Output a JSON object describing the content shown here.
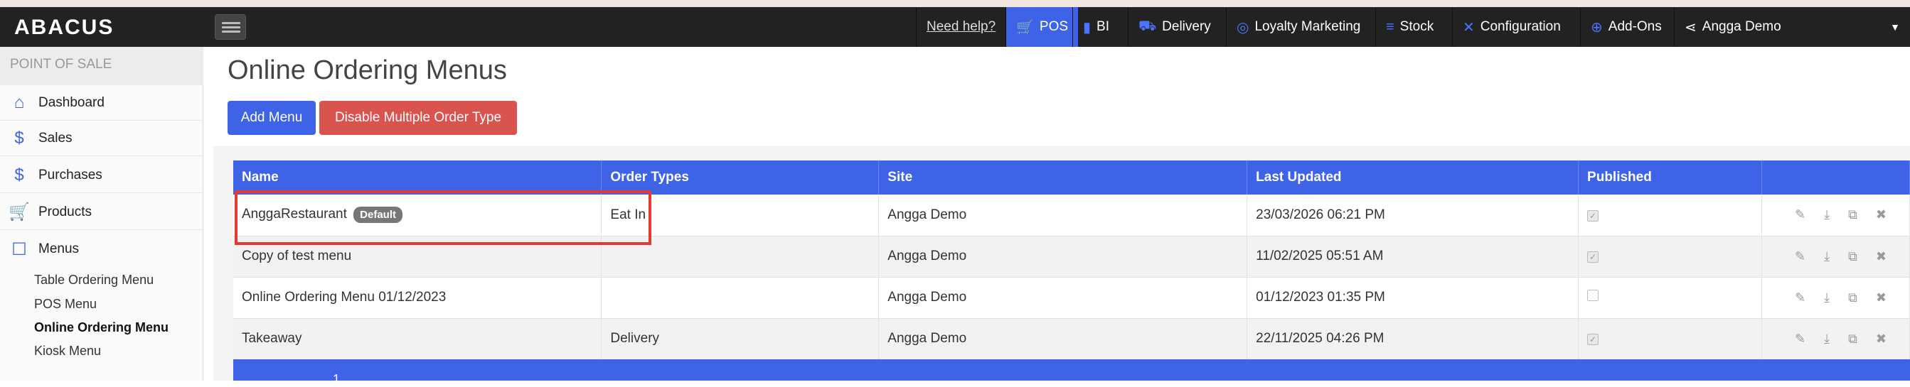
{
  "app": {
    "logo": "ABACUS"
  },
  "navbar": {
    "help": "Need help?",
    "items": [
      {
        "label": "POS",
        "icon": "cart-icon"
      },
      {
        "label": "BI",
        "icon": "bar-chart-icon"
      },
      {
        "label": "Delivery",
        "icon": "truck-icon"
      },
      {
        "label": "Loyalty Marketing",
        "icon": "loyalty-icon"
      },
      {
        "label": "Stock",
        "icon": "stock-icon"
      },
      {
        "label": "Configuration",
        "icon": "wrench-icon"
      },
      {
        "label": "Add-Ons",
        "icon": "plus-circle-icon"
      }
    ],
    "user": "Angga Demo"
  },
  "sidebar": {
    "section": "POINT OF SALE",
    "items": [
      {
        "label": "Dashboard",
        "icon": "home-icon"
      },
      {
        "label": "Sales",
        "icon": "dollar-icon"
      },
      {
        "label": "Purchases",
        "icon": "dollar-icon"
      },
      {
        "label": "Products",
        "icon": "cart-icon"
      },
      {
        "label": "Menus",
        "icon": "menu-book-icon"
      }
    ],
    "submenu": [
      "Table Ordering Menu",
      "POS Menu",
      "Online Ordering Menu",
      "Kiosk Menu"
    ]
  },
  "page": {
    "title": "Online Ordering Menus",
    "add_button": "Add Menu",
    "disable_button": "Disable Multiple Order Type"
  },
  "table": {
    "headers": [
      "Name",
      "Order Types",
      "Site",
      "Last Updated",
      "Published",
      ""
    ],
    "rows": [
      {
        "name": "AnggaRestaurant",
        "badge": "Default",
        "order_types": "Eat In",
        "site": "Angga Demo",
        "updated": "23/03/2026 06:21 PM",
        "published": true
      },
      {
        "name": "Copy of test menu",
        "badge": "",
        "order_types": "",
        "site": "Angga Demo",
        "updated": "11/02/2025 05:51 AM",
        "published": true
      },
      {
        "name": "Online Ordering Menu 01/12/2023",
        "badge": "",
        "order_types": "",
        "site": "Angga Demo",
        "updated": "01/12/2023 01:35 PM",
        "published": false
      },
      {
        "name": "Takeaway",
        "badge": "",
        "order_types": "Delivery",
        "site": "Angga Demo",
        "updated": "22/11/2025 04:26 PM",
        "published": true
      }
    ]
  },
  "pager": {
    "page": "1"
  }
}
